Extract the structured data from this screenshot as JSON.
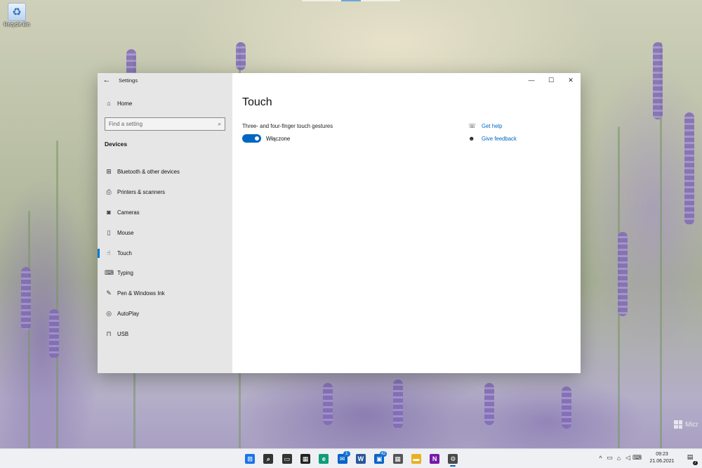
{
  "desktop": {
    "recycle_bin_label": "Recycle Bin",
    "watermark": "Micr"
  },
  "window": {
    "title": "Settings",
    "back_glyph": "←",
    "controls": {
      "minimize": "—",
      "maximize": "☐",
      "close": "✕"
    }
  },
  "sidebar": {
    "home_label": "Home",
    "search_placeholder": "Find a setting",
    "section_label": "Devices",
    "items": [
      {
        "label": "Bluetooth & other devices",
        "icon": "bluetooth-devices-icon",
        "glyph": "⊞"
      },
      {
        "label": "Printers & scanners",
        "icon": "printer-icon",
        "glyph": "⎙"
      },
      {
        "label": "Cameras",
        "icon": "camera-icon",
        "glyph": "◙"
      },
      {
        "label": "Mouse",
        "icon": "mouse-icon",
        "glyph": "▯"
      },
      {
        "label": "Touch",
        "icon": "touch-icon",
        "glyph": "☝",
        "active": true
      },
      {
        "label": "Typing",
        "icon": "keyboard-icon",
        "glyph": "⌨"
      },
      {
        "label": "Pen & Windows Ink",
        "icon": "pen-icon",
        "glyph": "✎"
      },
      {
        "label": "AutoPlay",
        "icon": "autoplay-icon",
        "glyph": "◎"
      },
      {
        "label": "USB",
        "icon": "usb-icon",
        "glyph": "⊓"
      }
    ]
  },
  "main": {
    "title": "Touch",
    "setting_label": "Three- and four-finger touch gestures",
    "toggle_state": "Włączone",
    "toggle_on": true,
    "help_links": [
      {
        "label": "Get help",
        "icon": "help-chat-icon",
        "glyph": "☏"
      },
      {
        "label": "Give feedback",
        "icon": "feedback-icon",
        "glyph": "☻"
      }
    ]
  },
  "taskbar": {
    "apps": [
      {
        "name": "start",
        "icon": "windows-start-icon",
        "glyph": "⊞",
        "color": "#1a73e8"
      },
      {
        "name": "search",
        "icon": "search-icon",
        "glyph": "⌕",
        "color": "#333333"
      },
      {
        "name": "task-view",
        "icon": "task-view-icon",
        "glyph": "▭",
        "color": "#333333"
      },
      {
        "name": "widgets",
        "icon": "widgets-icon",
        "glyph": "▦",
        "color": "#222222"
      },
      {
        "name": "edge",
        "icon": "edge-icon",
        "glyph": "e",
        "color": "#0f9d7a"
      },
      {
        "name": "mail",
        "icon": "mail-icon",
        "glyph": "✉",
        "color": "#0a64c8",
        "badge": "1"
      },
      {
        "name": "word",
        "icon": "word-icon",
        "glyph": "W",
        "color": "#2b579a"
      },
      {
        "name": "store",
        "icon": "store-icon",
        "glyph": "▣",
        "color": "#0a64c8",
        "badge": "42"
      },
      {
        "name": "calculator",
        "icon": "calculator-icon",
        "glyph": "▦",
        "color": "#555555"
      },
      {
        "name": "file-explorer",
        "icon": "folder-icon",
        "glyph": "▬",
        "color": "#e8b022"
      },
      {
        "name": "onenote",
        "icon": "onenote-icon",
        "glyph": "N",
        "color": "#7719aa"
      },
      {
        "name": "settings",
        "icon": "gear-icon",
        "glyph": "⚙",
        "color": "#4a4a4a",
        "active": true
      }
    ],
    "tray": [
      {
        "icon": "chevron-up-icon",
        "glyph": "^"
      },
      {
        "icon": "battery-icon",
        "glyph": "▭"
      },
      {
        "icon": "network-icon",
        "glyph": "⌂"
      },
      {
        "icon": "volume-icon",
        "glyph": "◁"
      },
      {
        "icon": "keyboard-icon",
        "glyph": "⌨"
      }
    ],
    "time": "09:23",
    "date": "21.06.2021",
    "notification_count": "7"
  }
}
